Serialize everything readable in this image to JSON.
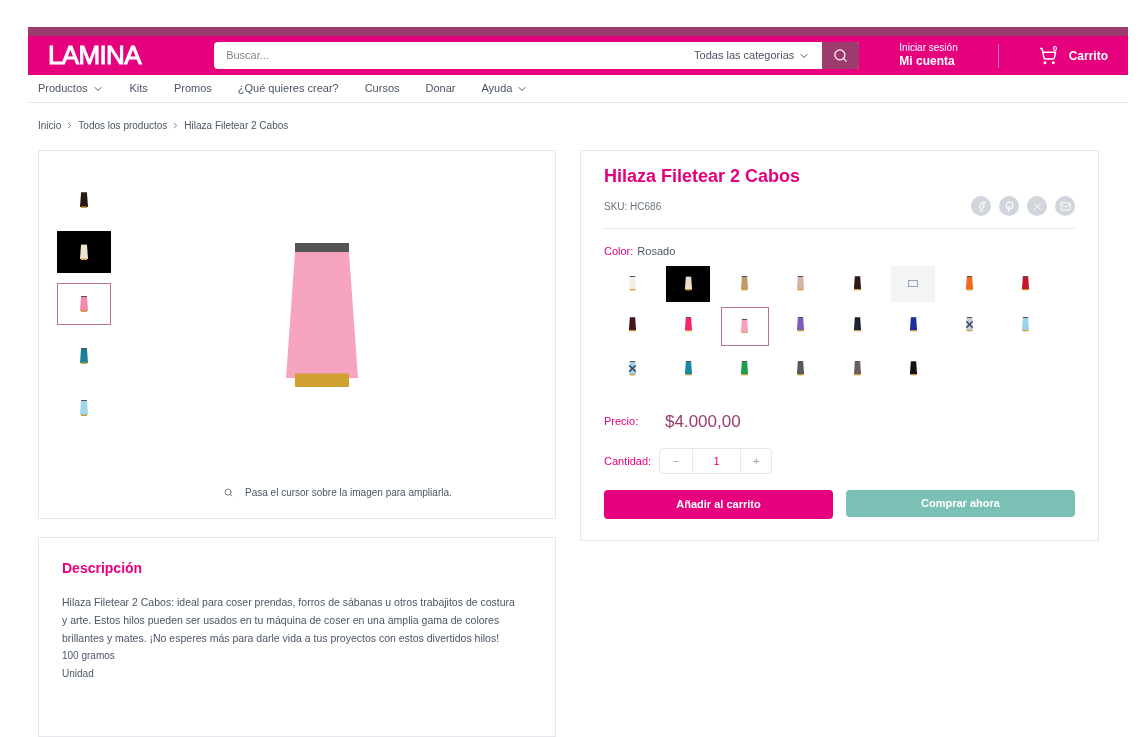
{
  "header": {
    "logo": "LAMINA",
    "search": {
      "placeholder": "Buscar...",
      "category": "Todas las categorias"
    },
    "account": {
      "line1": "Iniciar sesión",
      "line2": "Mi cuenta"
    },
    "cart": {
      "count": "0",
      "label": "Carrito"
    }
  },
  "nav": [
    {
      "label": "Productos",
      "dropdown": true
    },
    {
      "label": "Kits",
      "dropdown": false
    },
    {
      "label": "Promos",
      "dropdown": false
    },
    {
      "label": "¿Qué quieres crear?",
      "dropdown": false
    },
    {
      "label": "Cursos",
      "dropdown": false
    },
    {
      "label": "Donar",
      "dropdown": false
    },
    {
      "label": "Ayuda",
      "dropdown": true
    }
  ],
  "breadcrumb": [
    "Inicio",
    "Todos los productos",
    "Hilaza Filetear 2 Cabos"
  ],
  "gallery": {
    "thumbnails": [
      {
        "color": "#2a1614",
        "selected": false,
        "dark": false
      },
      {
        "color": "#f0e2d2",
        "selected": false,
        "dark": true
      },
      {
        "color": "#f48aaa",
        "selected": true,
        "dark": false
      },
      {
        "color": "#1a7f96",
        "selected": false,
        "dark": false
      },
      {
        "color": "#9fd6ea",
        "selected": false,
        "dark": false
      }
    ],
    "zoom_hint": "Pasa el cursor sobre la imagen para ampliarla."
  },
  "product": {
    "title": "Hilaza Filetear 2 Cabos",
    "sku": "SKU: HC686",
    "color_label": "Color:",
    "color_value": "Rosado",
    "swatches": [
      {
        "kind": "spool",
        "color": "#f3ede6",
        "selected": false,
        "unavailable": false
      },
      {
        "kind": "spool-dark",
        "color": "#ecdcc8",
        "selected": false,
        "unavailable": false
      },
      {
        "kind": "spool",
        "color": "#c4996e",
        "selected": false,
        "unavailable": false
      },
      {
        "kind": "spool",
        "color": "#d6b3a2",
        "selected": false,
        "unavailable": false
      },
      {
        "kind": "spool",
        "color": "#2e1816",
        "selected": false,
        "unavailable": false
      },
      {
        "kind": "placeholder",
        "selected": false,
        "unavailable": false
      },
      {
        "kind": "spool",
        "color": "#f06a1e",
        "selected": false,
        "unavailable": false
      },
      {
        "kind": "spool",
        "color": "#c4162a",
        "selected": false,
        "unavailable": false
      },
      {
        "kind": "spool",
        "color": "#4a1418",
        "selected": false,
        "unavailable": false
      },
      {
        "kind": "spool",
        "color": "#f6246e",
        "selected": false,
        "unavailable": false
      },
      {
        "kind": "spool",
        "color": "#f8a0bc",
        "selected": true,
        "unavailable": false
      },
      {
        "kind": "spool",
        "color": "#7b5cb8",
        "selected": false,
        "unavailable": false
      },
      {
        "kind": "spool",
        "color": "#1b2232",
        "selected": false,
        "unavailable": false
      },
      {
        "kind": "spool",
        "color": "#1c2f9a",
        "selected": false,
        "unavailable": false
      },
      {
        "kind": "spool",
        "color": "#c4ccd8",
        "selected": false,
        "unavailable": true
      },
      {
        "kind": "spool",
        "color": "#9ad4ea",
        "selected": false,
        "unavailable": false
      },
      {
        "kind": "spool",
        "color": "#9cd2ea",
        "selected": false,
        "unavailable": true
      },
      {
        "kind": "spool",
        "color": "#168aa6",
        "selected": false,
        "unavailable": false
      },
      {
        "kind": "spool",
        "color": "#1f9e4a",
        "selected": false,
        "unavailable": false
      },
      {
        "kind": "spool",
        "color": "#5a5a5e",
        "selected": false,
        "unavailable": false
      },
      {
        "kind": "spool",
        "color": "#6a5e5e",
        "selected": false,
        "unavailable": false
      },
      {
        "kind": "spool",
        "color": "#141414",
        "selected": false,
        "unavailable": false
      }
    ],
    "price_label": "Precio:",
    "price": "$4.000,00",
    "qty_label": "Cantidad:",
    "qty_minus": "−",
    "qty": "1",
    "qty_plus": "+",
    "add_button": "Añadir al carrito",
    "buy_button": "Comprar ahora"
  },
  "description": {
    "title": "Descripción",
    "text": "Hilaza Filetear 2 Cabos: ideal para coser prendas, forros de sábanas u otros trabajitos de costura y arte. Estos hilos pueden ser usados en tu máquina de coser en una amplia gama de colores brillantes y mates. ¡No esperes más para darle vida a tus proyectos con estos divertidos hilos!",
    "lines": [
      "100 gramos",
      "Unidad"
    ]
  }
}
